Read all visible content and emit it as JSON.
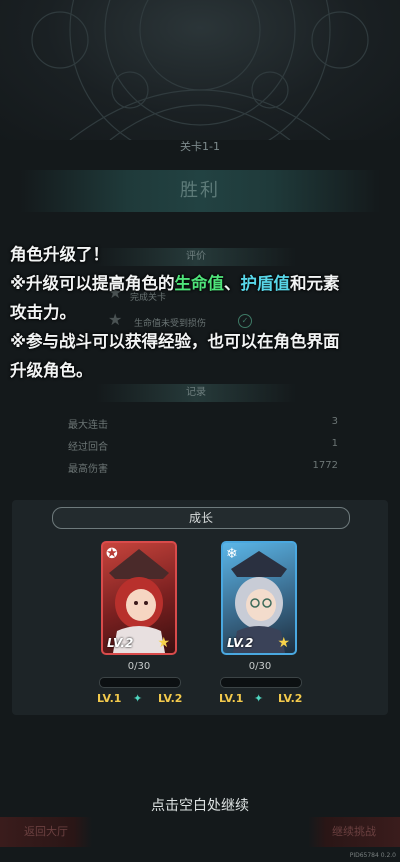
{
  "stage": {
    "title": "关卡1-1"
  },
  "result": {
    "title": "胜利"
  },
  "evaluation": {
    "header": "评价",
    "rows": [
      {
        "text": "完成关卡"
      },
      {
        "text": "生命值未受到损伤"
      }
    ]
  },
  "records": {
    "header": "记录",
    "rows": [
      {
        "label": "最大连击",
        "value": "3"
      },
      {
        "label": "经过回合",
        "value": "1"
      },
      {
        "label": "最高伤害",
        "value": "1772"
      }
    ]
  },
  "tip": {
    "line1": "角色升级了！",
    "line2_prefix": "※升级可以提高角色的",
    "line2_hp": "生命值",
    "line2_sep": "、",
    "line2_shield": "护盾值",
    "line2_suffix": "和元素",
    "line3": "攻击力。",
    "line4": "※参与战斗可以获得经验，也可以在角色界面",
    "line5": "升级角色。"
  },
  "growth": {
    "header": "成长",
    "characters": [
      {
        "level_badge": "LV.2",
        "exp": "0/30",
        "exp_fraction": 0,
        "lv_from": "LV.1",
        "lv_to": "LV.2",
        "element_icon": "fire-element-icon",
        "border_color": "#d94b4b"
      },
      {
        "level_badge": "LV.2",
        "exp": "0/30",
        "exp_fraction": 0,
        "lv_from": "LV.1",
        "lv_to": "LV.2",
        "element_icon": "ice-element-icon",
        "border_color": "#4aa8e0"
      }
    ]
  },
  "continue_text": "点击空白处继续",
  "buttons": {
    "left": "返回大厅",
    "right": "继续挑战"
  },
  "version": "PID65784 0.2.0"
}
